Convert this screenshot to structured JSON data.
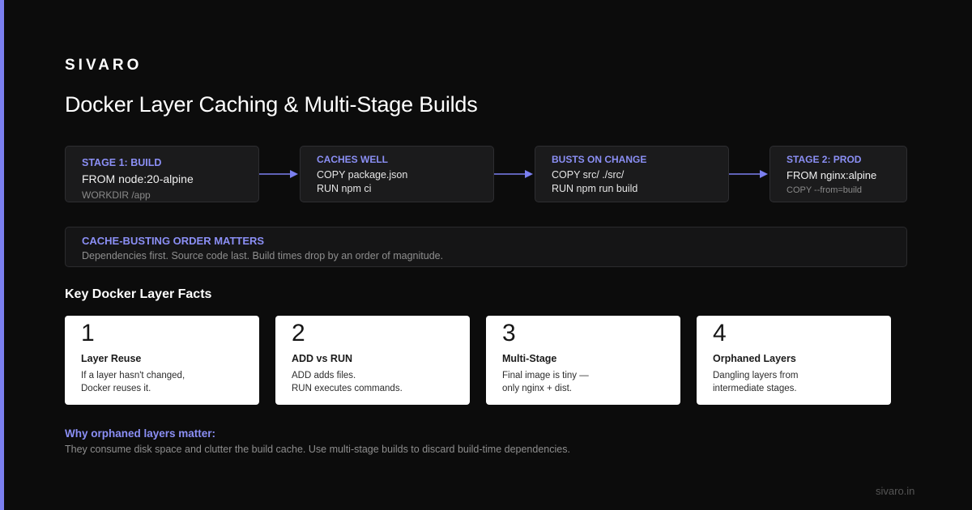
{
  "brand": "SIVARO",
  "title": "Docker Layer Caching & Multi-Stage Builds",
  "colors": {
    "background": "#0c0c0c",
    "accent": "#8b8ff5",
    "accent_bar": "#7b7ff0",
    "box_bg": "#1b1b1c",
    "card_bg": "#ffffff"
  },
  "pipeline": [
    {
      "heading": "STAGE 1: BUILD",
      "line1": "FROM node:20-alpine",
      "line2": "WORKDIR /app"
    },
    {
      "heading": "CACHES WELL",
      "code1": "COPY package.json",
      "code2": "RUN npm ci"
    },
    {
      "heading": "BUSTS ON CHANGE",
      "code1": "COPY src/ ./src/",
      "code2": "RUN npm run build"
    },
    {
      "heading": "STAGE 2: PROD",
      "line1": "FROM nginx:alpine",
      "line2": "COPY --from=build"
    }
  ],
  "arrow_icon": "arrow-right-icon",
  "callout": {
    "heading": "CACHE-BUSTING ORDER MATTERS",
    "body": "Dependencies first. Source code last. Build times drop by an order of magnitude."
  },
  "facts_title": "Key Docker Layer Facts",
  "facts": [
    {
      "num": "1",
      "name": "Layer Reuse",
      "desc1": "If a layer hasn't changed,",
      "desc2": "Docker reuses it."
    },
    {
      "num": "2",
      "name": "ADD vs RUN",
      "desc1": "ADD adds files.",
      "desc2": "RUN executes commands."
    },
    {
      "num": "3",
      "name": "Multi-Stage",
      "desc1": "Final image is tiny —",
      "desc2": "only nginx + dist."
    },
    {
      "num": "4",
      "name": "Orphaned Layers",
      "desc1": "Dangling layers from",
      "desc2": "intermediate stages."
    }
  ],
  "why": {
    "title": "Why orphaned layers matter:",
    "body": "They consume disk space and clutter the build cache. Use multi-stage builds to discard build-time dependencies."
  },
  "footer": "sivaro.in"
}
